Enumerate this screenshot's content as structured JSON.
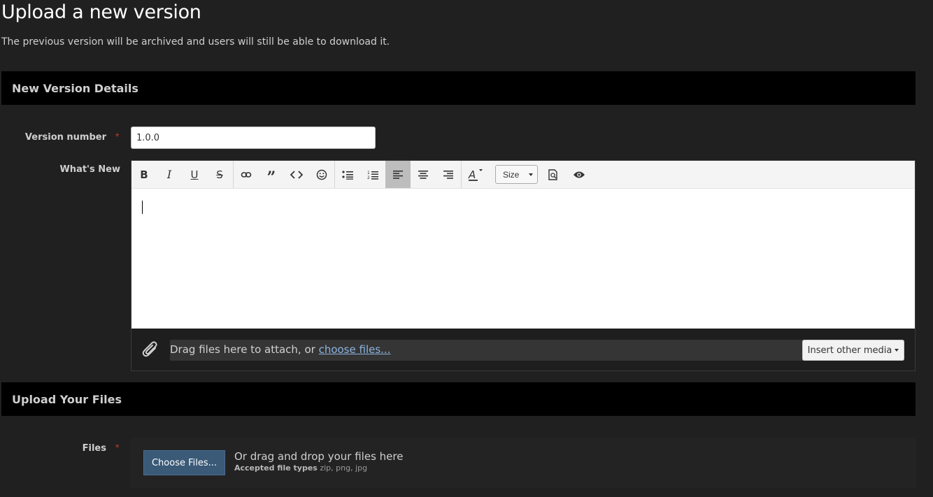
{
  "page": {
    "title": "Upload a new version",
    "description": "The previous version will be archived and users will still be able to download it."
  },
  "sections": {
    "details_title": "New Version Details",
    "files_title": "Upload Your Files"
  },
  "version_field": {
    "label": "Version number",
    "value": "1.0.0",
    "required_mark": "*"
  },
  "whats_new": {
    "label": "What's New",
    "toolbar": {
      "size_label": "Size",
      "buttons": [
        "bold-icon",
        "italic-icon",
        "underline-icon",
        "strikethrough-icon",
        "link-icon",
        "quote-icon",
        "code-icon",
        "smiley-icon",
        "bulleted-list-icon",
        "numbered-list-icon",
        "align-left-icon",
        "align-center-icon",
        "align-right-icon",
        "text-color-icon",
        "size-dropdown",
        "preview-icon",
        "eye-icon"
      ],
      "active_button": "align-left-icon"
    },
    "attach_text": "Drag files here to attach, or ",
    "attach_link": "choose files...",
    "insert_media": "Insert other media"
  },
  "files_field": {
    "label": "Files",
    "required_mark": "*",
    "choose_button": "Choose Files...",
    "drop_text": "Or drag and drop your files here",
    "accepted_label": "Accepted file types",
    "accepted_types": "zip, png, jpg"
  },
  "colors": {
    "background": "#202020",
    "header_bar": "#000000",
    "required": "#c0392b",
    "link": "#8cb4e0",
    "primary_button": "#3a5a78"
  }
}
